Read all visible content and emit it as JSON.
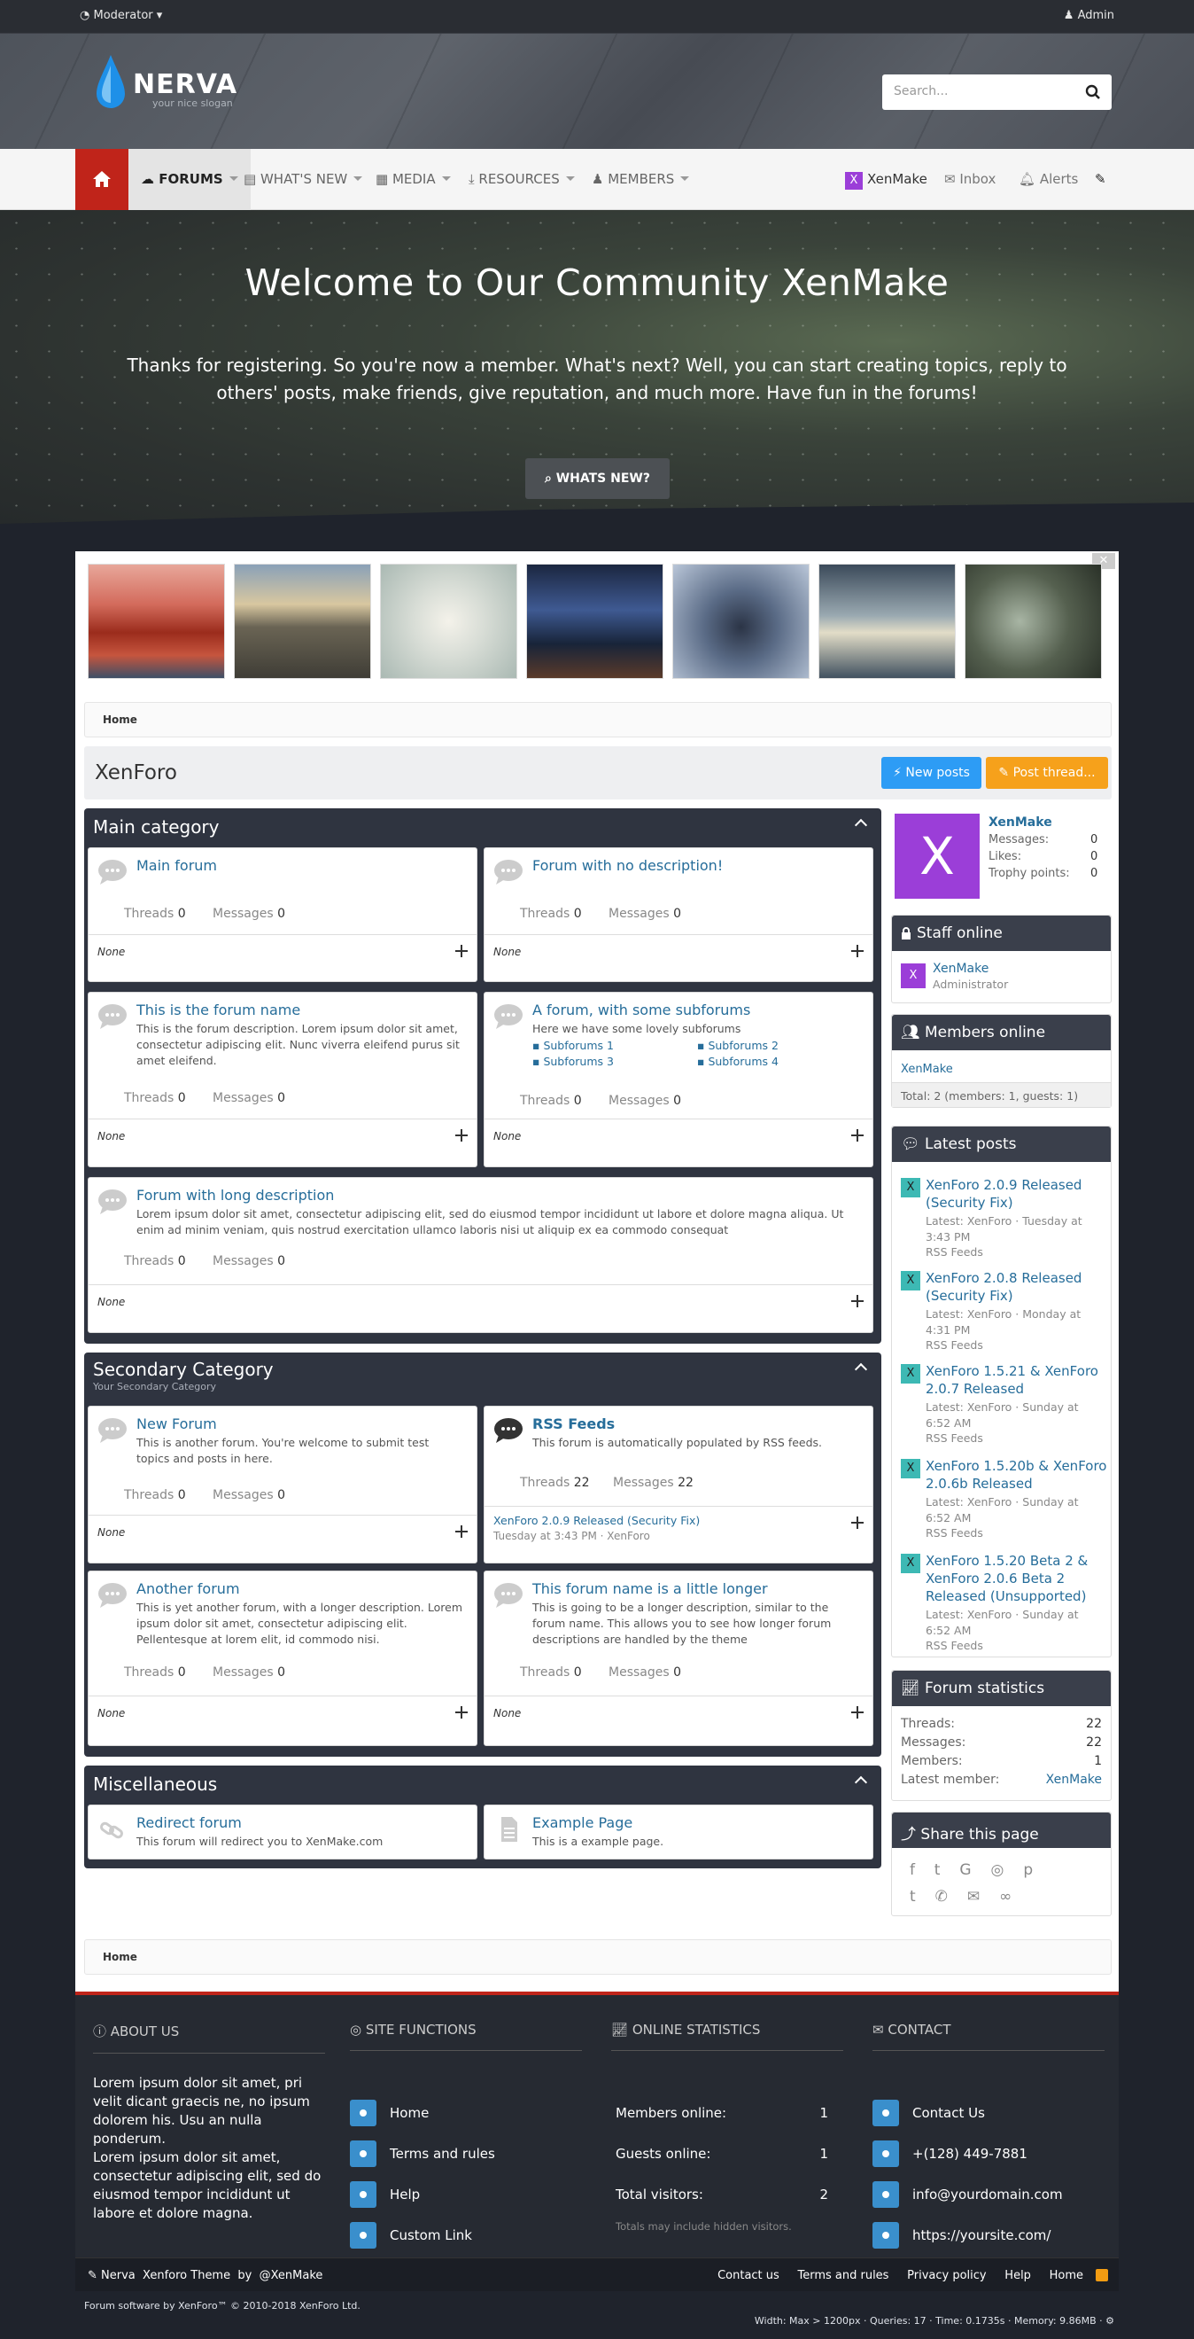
{
  "topbar": {
    "left": "Moderator",
    "right": "Admin"
  },
  "brand": {
    "name": "NERVA",
    "slogan": "your nice slogan"
  },
  "search": {
    "placeholder": "Search..."
  },
  "nav": {
    "forums": "FORUMS",
    "whats_new": "WHAT'S NEW",
    "media": "MEDIA",
    "resources": "RESOURCES",
    "members": "MEMBERS",
    "user": "XenMake",
    "inbox": "Inbox",
    "alerts": "Alerts"
  },
  "hero": {
    "title": "Welcome to Our Community XenMake",
    "text": "Thanks for registering. So you're now a member. What's next? Well, you can start creating topics, reply to others' posts, make friends, give reputation, and much more. Have fun in the forums!",
    "button": "WHATS NEW?"
  },
  "breadcrumb": {
    "home": "Home"
  },
  "page": {
    "title": "XenForo",
    "new_posts": "New posts",
    "post_thread": "Post thread..."
  },
  "categories": [
    {
      "title": "Main category",
      "forums": [
        {
          "name": "Main forum",
          "desc": "",
          "threads": "0",
          "messages": "0",
          "last": "None"
        },
        {
          "name": "Forum with no description!",
          "desc": "",
          "threads": "0",
          "messages": "0",
          "last": "None"
        },
        {
          "name": "This is the forum name",
          "desc": "This is the forum description. Lorem ipsum dolor sit amet, consectetur adipiscing elit. Nunc viverra eleifend purus sit amet eleifend.",
          "threads": "0",
          "messages": "0",
          "last": "None"
        },
        {
          "name": "A forum, with some subforums",
          "desc": "Here we have some lovely subforums",
          "threads": "0",
          "messages": "0",
          "last": "None",
          "subforums": [
            "Subforums 1",
            "Subforums 2",
            "Subforums 3",
            "Subforums 4"
          ]
        },
        {
          "name": "Forum with long description",
          "desc": "Lorem ipsum dolor sit amet, consectetur adipiscing elit, sed do eiusmod tempor incididunt ut labore et dolore magna aliqua. Ut enim ad minim veniam, quis nostrud exercitation ullamco laboris nisi ut aliquip ex ea commodo consequat",
          "threads": "0",
          "messages": "0",
          "last": "None"
        }
      ]
    },
    {
      "title": "Secondary Category",
      "subtitle": "Your Secondary Category",
      "forums": [
        {
          "name": "New Forum",
          "desc": "This is another forum. You're welcome to submit test topics and posts in here.",
          "threads": "0",
          "messages": "0",
          "last": "None"
        },
        {
          "name": "RSS Feeds",
          "desc": "This forum is automatically populated by RSS feeds.",
          "threads": "22",
          "messages": "22",
          "last_title": "XenForo 2.0.9 Released (Security Fix)",
          "last_meta": "Tuesday at 3:43 PM · XenForo"
        },
        {
          "name": "Another forum",
          "desc": "This is yet another forum, with a longer description. Lorem ipsum dolor sit amet, consectetur adipiscing elit. Pellentesque at lorem elit, id commodo nisi.",
          "threads": "0",
          "messages": "0",
          "last": "None"
        },
        {
          "name": "This forum name is a little longer",
          "desc": "This is going to be a longer description, similar to the forum name. This allows you to see how longer forum descriptions are handled by the theme",
          "threads": "0",
          "messages": "0",
          "last": "None"
        }
      ]
    },
    {
      "title": "Miscellaneous",
      "forums": [
        {
          "name": "Redirect forum",
          "desc": "This forum will redirect you to XenMake.com"
        },
        {
          "name": "Example Page",
          "desc": "This is a example page."
        }
      ]
    }
  ],
  "labels": {
    "threads": "Threads",
    "messages": "Messages"
  },
  "user_card": {
    "name": "XenMake",
    "avatar_letter": "X",
    "messages_label": "Messages:",
    "messages": "0",
    "likes_label": "Likes:",
    "likes": "0",
    "trophy_label": "Trophy points:",
    "trophy": "0"
  },
  "staff": {
    "title": "Staff online",
    "name": "XenMake",
    "role": "Administrator"
  },
  "members_online": {
    "title": "Members online",
    "name": "XenMake",
    "total": "Total: 2 (members: 1, guests: 1)"
  },
  "latest": {
    "title": "Latest posts",
    "items": [
      {
        "title": "XenForo 2.0.9 Released (Security Fix)",
        "meta": "Latest: XenForo · Tuesday at 3:43 PM",
        "forum": "RSS Feeds"
      },
      {
        "title": "XenForo 2.0.8 Released (Security Fix)",
        "meta": "Latest: XenForo · Monday at 4:31 PM",
        "forum": "RSS Feeds"
      },
      {
        "title": "XenForo 1.5.21 & XenForo 2.0.7 Released",
        "meta": "Latest: XenForo · Sunday at 6:52 AM",
        "forum": "RSS Feeds"
      },
      {
        "title": "XenForo 1.5.20b & XenForo 2.0.6b Released",
        "meta": "Latest: XenForo · Sunday at 6:52 AM",
        "forum": "RSS Feeds"
      },
      {
        "title": "XenForo 1.5.20 Beta 2 & XenForo 2.0.6 Beta 2 Released (Unsupported)",
        "meta": "Latest: XenForo · Sunday at 6:52 AM",
        "forum": "RSS Feeds"
      }
    ]
  },
  "stats": {
    "title": "Forum statistics",
    "threads_label": "Threads:",
    "threads": "22",
    "messages_label": "Messages:",
    "messages": "22",
    "members_label": "Members:",
    "members": "1",
    "latest_label": "Latest member:",
    "latest": "XenMake"
  },
  "share": {
    "title": "Share this page"
  },
  "footer": {
    "about_title": "ABOUT US",
    "about_text": "Lorem ipsum dolor sit amet, pri velit dicant graecis ne, no ipsum dolorem his. Usu an nulla ponderum.\nLorem ipsum dolor sit amet, consectetur adipiscing elit, sed do eiusmod tempor incididunt ut labore et dolore magna.",
    "functions_title": "SITE FUNCTIONS",
    "functions": [
      "Home",
      "Terms and rules",
      "Help",
      "Custom Link"
    ],
    "stats_title": "ONLINE STATISTICS",
    "members_online": "Members online:",
    "members_online_v": "1",
    "guests_online": "Guests online:",
    "guests_online_v": "1",
    "total_visitors": "Total visitors:",
    "total_visitors_v": "2",
    "note": "Totals may include hidden visitors.",
    "contact_title": "CONTACT",
    "contact": [
      "Contact Us",
      "+(128) 449-7881",
      "info@yourdomain.com",
      "https://yoursite.com/"
    ]
  },
  "copyright": {
    "theme": "Nerva  Xenforo Theme  by  @XenMake",
    "links": [
      "Contact us",
      "Terms and rules",
      "Privacy policy",
      "Help",
      "Home"
    ],
    "software": "Forum software by XenForo™ © 2010-2018 XenForo Ltd.",
    "debug": "Width: Max > 1200px · Queries: 17 · Time: 0.1735s · Memory: 9.86MB · ⚙"
  },
  "colors": {
    "accent": "#c0241a",
    "link": "#266d9a",
    "blue": "#2d9cf5",
    "orange": "#f6a11b",
    "dark": "#2f3440"
  }
}
